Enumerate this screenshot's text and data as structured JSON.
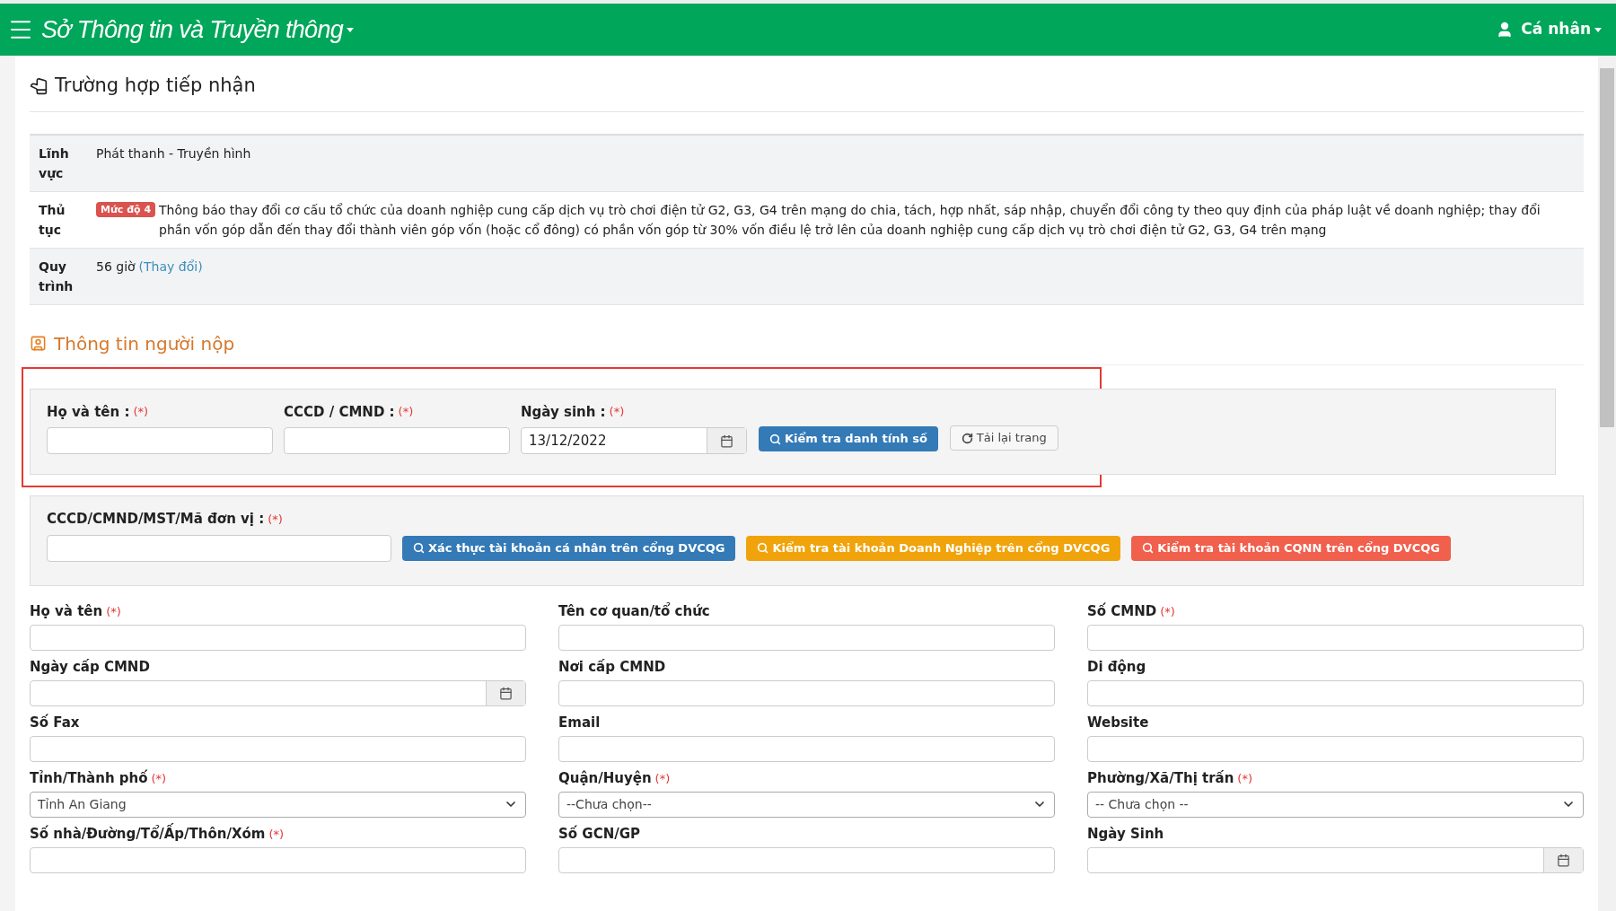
{
  "header": {
    "title": "Sở Thông tin và Truyền thông",
    "user": "Cá nhân"
  },
  "case": {
    "heading": "Trường hợp tiếp nhận",
    "rows": [
      {
        "label": "Lĩnh vực",
        "value": "Phát thanh - Truyền hình"
      },
      {
        "label": "Thủ tục",
        "badge": "Mức độ 4",
        "value": "Thông báo thay đổi cơ cấu tổ chức của doanh nghiệp cung cấp dịch vụ trò chơi điện tử G2, G3, G4 trên mạng do chia, tách, hợp nhất, sáp nhập, chuyển đổi công ty theo quy định của pháp luật về doanh nghiệp; thay đổi phần vốn góp dẫn đến thay đổi thành viên góp vốn (hoặc cổ đông) có phần vốn góp từ 30% vốn điều lệ trở lên của doanh nghiệp cung cấp dịch vụ trò chơi điện tử G2, G3, G4 trên mạng"
      },
      {
        "label": "Quy trình",
        "value": "56 giờ",
        "link": "(Thay đổi)"
      }
    ]
  },
  "submitter": {
    "heading": "Thông tin người nộp",
    "identity": {
      "fields": [
        {
          "label": "Họ và tên :",
          "required": "(*)",
          "kind": "text"
        },
        {
          "label": "CCCD / CMND :",
          "required": "(*)",
          "kind": "text"
        },
        {
          "label": "Ngày sinh :",
          "required": "(*)",
          "kind": "date",
          "value": "13/12/2022"
        }
      ],
      "check_button": "Kiểm tra danh tính số",
      "reload_button": "Tải lại trang"
    },
    "lookup": {
      "label": "CCCD/CMND/MST/Mã đơn vị :",
      "required": "(*)",
      "buttons": [
        {
          "label": "Xác thực tài khoản cá nhân trên cổng DVCQG",
          "color": "#337ab7"
        },
        {
          "label": "Kiểm tra tài khoản Doanh Nghiệp trên cổng DVCQG",
          "color": "#f0a30a"
        },
        {
          "label": "Kiểm tra tài khoản CQNN trên cổng DVCQG",
          "color": "#f0604d"
        }
      ]
    },
    "form": [
      {
        "label": "Họ và tên",
        "required": "(*)",
        "kind": "text"
      },
      {
        "label": "Tên cơ quan/tổ chức",
        "kind": "text"
      },
      {
        "label": "Số CMND",
        "required": "(*)",
        "kind": "text"
      },
      {
        "label": "Ngày cấp CMND",
        "kind": "date"
      },
      {
        "label": "Nơi cấp CMND",
        "kind": "text"
      },
      {
        "label": "Di động",
        "kind": "text"
      },
      {
        "label": "Số Fax",
        "kind": "text"
      },
      {
        "label": "Email",
        "kind": "text"
      },
      {
        "label": "Website",
        "kind": "text"
      },
      {
        "label": "Tỉnh/Thành phố",
        "required": "(*)",
        "kind": "select",
        "value": "Tỉnh An Giang"
      },
      {
        "label": "Quận/Huyện",
        "required": "(*)",
        "kind": "select",
        "value": "--Chưa chọn--"
      },
      {
        "label": "Phường/Xã/Thị trấn",
        "required": "(*)",
        "kind": "select",
        "value": "-- Chưa chọn --"
      },
      {
        "label": "Số nhà/Đường/Tổ/Ấp/Thôn/Xóm",
        "required": "(*)",
        "kind": "text"
      },
      {
        "label": "Số GCN/GP",
        "kind": "text"
      },
      {
        "label": "Ngày Sinh",
        "kind": "date"
      }
    ]
  }
}
